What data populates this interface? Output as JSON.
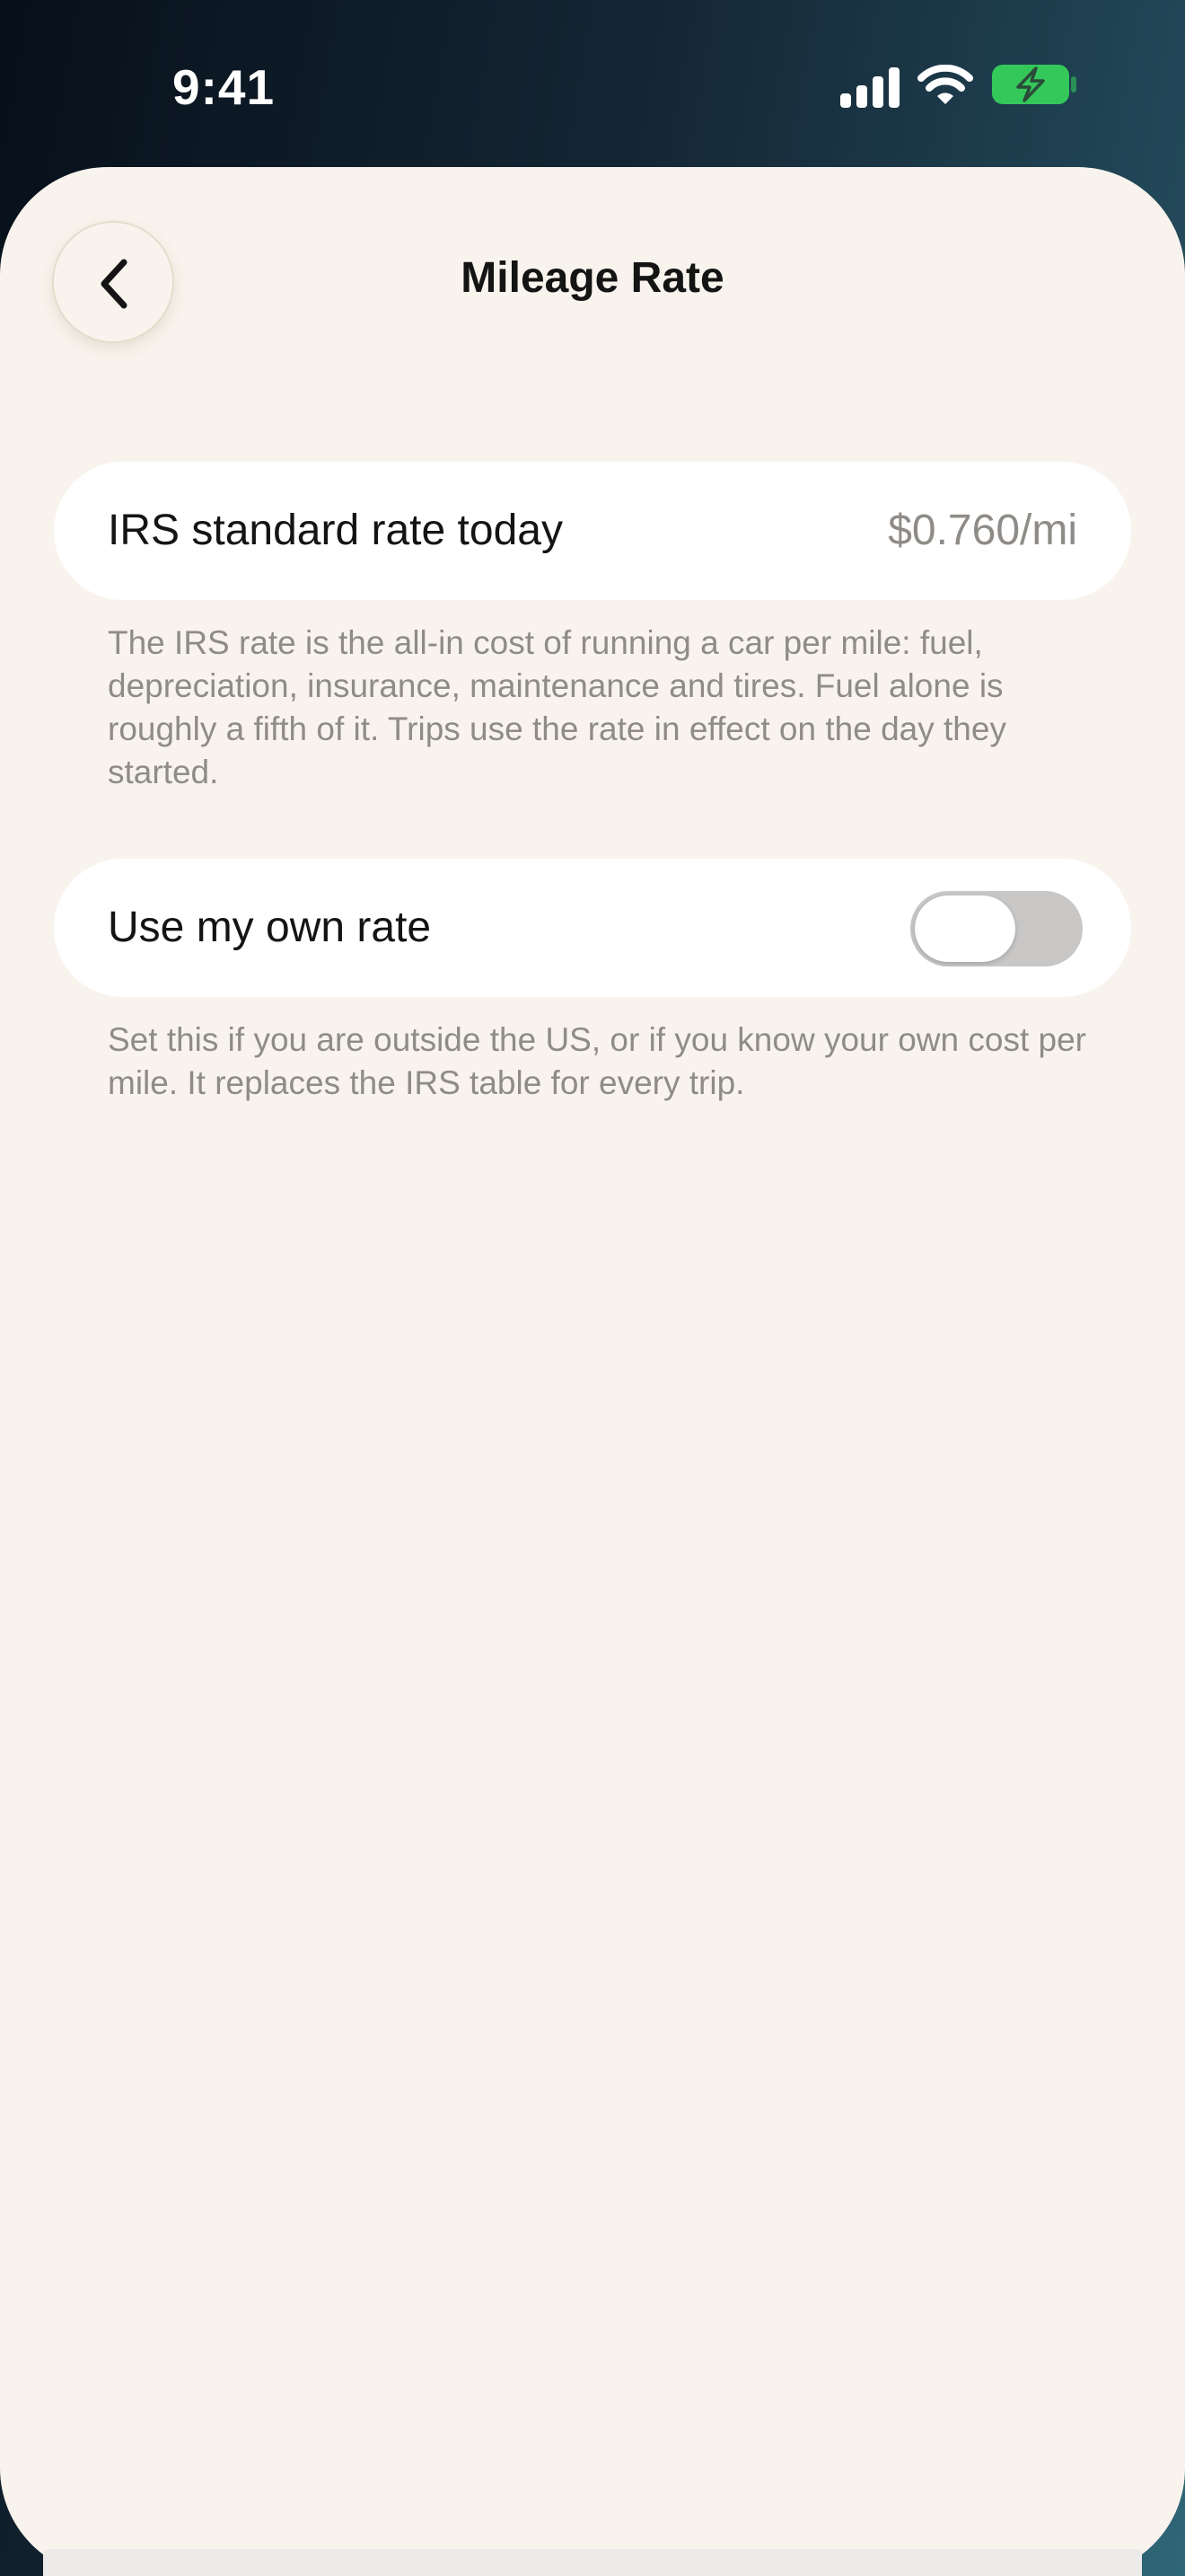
{
  "status_bar": {
    "time": "9:41",
    "icons": [
      "cellular-signal-icon",
      "wifi-icon",
      "battery-charging-icon"
    ],
    "battery_color": "#34c759"
  },
  "nav": {
    "back_icon": "chevron-left-icon",
    "title": "Mileage Rate"
  },
  "irs_rate": {
    "label": "IRS standard rate today",
    "value": "$0.760/mi",
    "note": "The IRS rate is the all-in cost of running a car per mile: fuel, depreciation, insurance, maintenance and tires. Fuel alone is roughly a fifth of it. Trips use the rate in effect on the day they started."
  },
  "own_rate": {
    "label": "Use my own rate",
    "enabled": false,
    "note": "Set this if you are outside the US, or if you know your own cost per mile. It replaces the IRS table for every trip."
  },
  "colors": {
    "background": "#f8f4ed",
    "card": "#ffffff",
    "secondary_text": "#8f8c88",
    "toggle_off": "#c8c7c6"
  }
}
